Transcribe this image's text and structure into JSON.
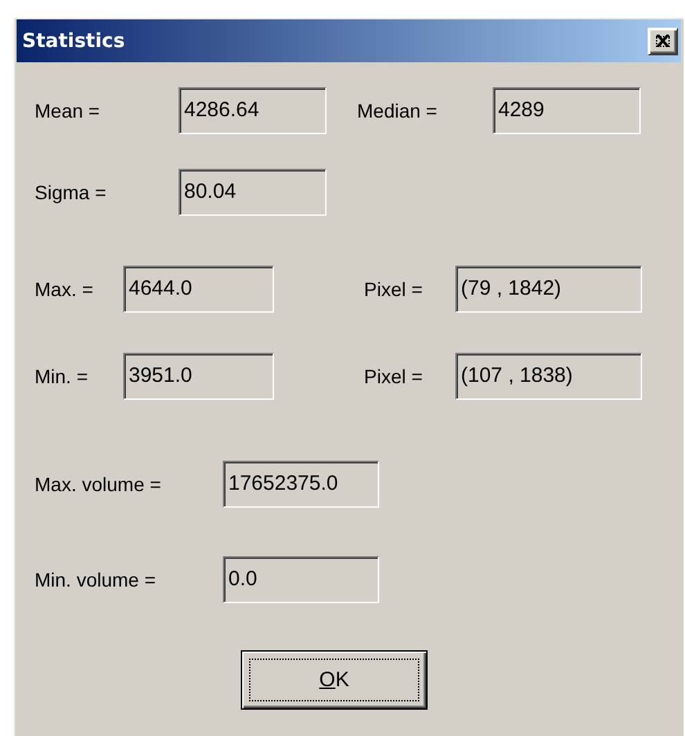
{
  "window": {
    "title": "Statistics"
  },
  "rows": [
    {
      "kind": "stats",
      "items": [
        {
          "label": "Mean =",
          "value": "4286.64"
        },
        {
          "label": "Median =",
          "value": "4289"
        }
      ]
    },
    {
      "kind": "stats",
      "items": [
        {
          "label": "Sigma =",
          "value": "80.04"
        }
      ]
    },
    {
      "kind": "extrema",
      "items": [
        {
          "label": "Max. =",
          "value": "4644.0"
        },
        {
          "label": "Pixel =",
          "value": "(79 , 1842)"
        }
      ]
    },
    {
      "kind": "extrema",
      "items": [
        {
          "label": "Min. =",
          "value": "3951.0"
        },
        {
          "label": "Pixel =",
          "value": "(107 , 1838)"
        }
      ]
    },
    {
      "kind": "volume",
      "items": [
        {
          "label": "Max. volume =",
          "value": "17652375.0"
        }
      ]
    },
    {
      "kind": "volume",
      "items": [
        {
          "label": "Min. volume =",
          "value": "0.0"
        }
      ]
    }
  ],
  "buttons": [
    {
      "label": "OK",
      "default": true
    }
  ]
}
